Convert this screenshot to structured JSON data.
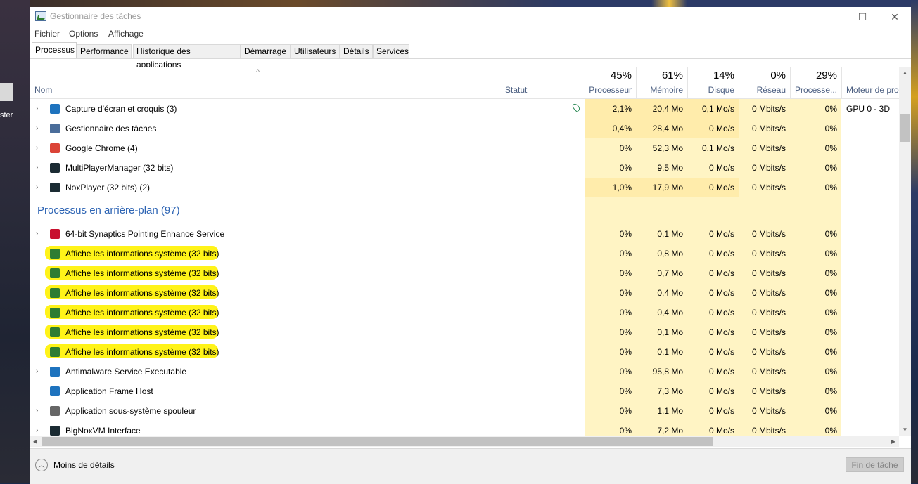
{
  "window": {
    "title": "Gestionnaire des tâches",
    "minimize": "—",
    "maximize": "☐",
    "close": "✕"
  },
  "desktop": {
    "icon_label": "ster"
  },
  "menu": [
    "Fichier",
    "Options",
    "Affichage"
  ],
  "tabs": [
    "Processus",
    "Performance",
    "Historique des applications",
    "Démarrage",
    "Utilisateurs",
    "Détails",
    "Services"
  ],
  "active_tab": "Processus",
  "header": {
    "sort_caret": "^",
    "name": "Nom",
    "status": "Statut",
    "columns": [
      {
        "pct": "45%",
        "label": "Processeur"
      },
      {
        "pct": "61%",
        "label": "Mémoire"
      },
      {
        "pct": "14%",
        "label": "Disque"
      },
      {
        "pct": "0%",
        "label": "Réseau"
      },
      {
        "pct": "29%",
        "label": "Processe..."
      },
      {
        "pct": "",
        "label": "Moteur de proces"
      }
    ]
  },
  "apps": [
    {
      "name": "Capture d'écran et croquis (3)",
      "cpu": "2,1%",
      "mem": "20,4 Mo",
      "disk": "0,1 Mo/s",
      "net": "0 Mbits/s",
      "gpu": "0%",
      "gpue": "GPU 0 - 3D",
      "icon_color": "#1e73be"
    },
    {
      "name": "Gestionnaire des tâches",
      "cpu": "0,4%",
      "mem": "28,4 Mo",
      "disk": "0 Mo/s",
      "net": "0 Mbits/s",
      "gpu": "0%",
      "gpue": "",
      "icon_color": "#4a6d9a"
    },
    {
      "name": "Google Chrome (4)",
      "cpu": "0%",
      "mem": "52,3 Mo",
      "disk": "0,1 Mo/s",
      "net": "0 Mbits/s",
      "gpu": "0%",
      "gpue": "",
      "icon_color": "#db4437"
    },
    {
      "name": "MultiPlayerManager (32 bits)",
      "cpu": "0%",
      "mem": "9,5 Mo",
      "disk": "0 Mo/s",
      "net": "0 Mbits/s",
      "gpu": "0%",
      "gpue": "",
      "icon_color": "#1b2b33"
    },
    {
      "name": "NoxPlayer (32 bits) (2)",
      "cpu": "1,0%",
      "mem": "17,9 Mo",
      "disk": "0 Mo/s",
      "net": "0 Mbits/s",
      "gpu": "0%",
      "gpue": "",
      "icon_color": "#1b2b33"
    }
  ],
  "background_section": "Processus en arrière-plan (97)",
  "background": [
    {
      "name": "64-bit Synaptics Pointing Enhance Service",
      "cpu": "0%",
      "mem": "0,1 Mo",
      "disk": "0 Mo/s",
      "net": "0 Mbits/s",
      "gpu": "0%",
      "icon_color": "#c8102e"
    },
    {
      "name": "Affiche les informations système (32 bits)",
      "cpu": "0%",
      "mem": "0,8 Mo",
      "disk": "0 Mo/s",
      "net": "0 Mbits/s",
      "gpu": "0%",
      "icon_color": "#2e7d32"
    },
    {
      "name": "Affiche les informations système (32 bits)",
      "cpu": "0%",
      "mem": "0,7 Mo",
      "disk": "0 Mo/s",
      "net": "0 Mbits/s",
      "gpu": "0%",
      "icon_color": "#2e7d32"
    },
    {
      "name": "Affiche les informations système (32 bits)",
      "cpu": "0%",
      "mem": "0,4 Mo",
      "disk": "0 Mo/s",
      "net": "0 Mbits/s",
      "gpu": "0%",
      "icon_color": "#2e7d32"
    },
    {
      "name": "Affiche les informations système (32 bits)",
      "cpu": "0%",
      "mem": "0,4 Mo",
      "disk": "0 Mo/s",
      "net": "0 Mbits/s",
      "gpu": "0%",
      "icon_color": "#2e7d32"
    },
    {
      "name": "Affiche les informations système (32 bits)",
      "cpu": "0%",
      "mem": "0,1 Mo",
      "disk": "0 Mo/s",
      "net": "0 Mbits/s",
      "gpu": "0%",
      "icon_color": "#2e7d32"
    },
    {
      "name": "Affiche les informations système (32 bits)",
      "cpu": "0%",
      "mem": "0,1 Mo",
      "disk": "0 Mo/s",
      "net": "0 Mbits/s",
      "gpu": "0%",
      "icon_color": "#2e7d32"
    },
    {
      "name": "Antimalware Service Executable",
      "cpu": "0%",
      "mem": "95,8 Mo",
      "disk": "0 Mo/s",
      "net": "0 Mbits/s",
      "gpu": "0%",
      "icon_color": "#1e73be"
    },
    {
      "name": "Application Frame Host",
      "cpu": "0%",
      "mem": "7,3 Mo",
      "disk": "0 Mo/s",
      "net": "0 Mbits/s",
      "gpu": "0%",
      "icon_color": "#1e73be"
    },
    {
      "name": "Application sous-système spouleur",
      "cpu": "0%",
      "mem": "1,1 Mo",
      "disk": "0 Mo/s",
      "net": "0 Mbits/s",
      "gpu": "0%",
      "icon_color": "#666666"
    },
    {
      "name": "BigNoxVM Interface",
      "cpu": "0%",
      "mem": "7,2 Mo",
      "disk": "0 Mo/s",
      "net": "0 Mbits/s",
      "gpu": "0%",
      "icon_color": "#1b2b33"
    }
  ],
  "footer": {
    "fewer_details": "Moins de détails",
    "end_task": "Fin de tâche"
  },
  "colors": {
    "accent": "#2d64b4",
    "heat_light": "#fff4c4",
    "heat_mid": "#ffecab",
    "highlight": "#fff200"
  }
}
